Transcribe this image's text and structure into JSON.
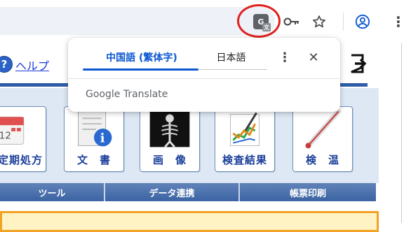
{
  "translate_popup": {
    "source_language": "中国語 (繁体字)",
    "target_language": "日本語",
    "more_glyph": "⋮",
    "close_glyph": "✕",
    "brand": "Google Translate"
  },
  "toolbar": {
    "translate_icon": "google-translate-icon",
    "key_icon": "key-icon",
    "star_icon": "star-icon",
    "account_icon": "account-icon",
    "menu_glyph": "⋮"
  },
  "app": {
    "help_label": "ヘルプ",
    "help_glyph": "?",
    "tiles": [
      {
        "label": "定期処方",
        "icon": "calendar-icon"
      },
      {
        "label": "文　書",
        "icon": "document-icon"
      },
      {
        "label": "画　像",
        "icon": "xray-icon"
      },
      {
        "label": "検査結果",
        "icon": "chart-icon"
      },
      {
        "label": "検　温",
        "icon": "thermometer-icon"
      }
    ],
    "tabs": [
      "ツール",
      "データ連携",
      "帳票印刷"
    ]
  },
  "colors": {
    "accent_blue": "#0b57d0",
    "highlight_red": "#e0201c",
    "tile_label": "#1a3f9a",
    "tab_bar": "#3c64a3",
    "orange_border": "#f2a224"
  }
}
